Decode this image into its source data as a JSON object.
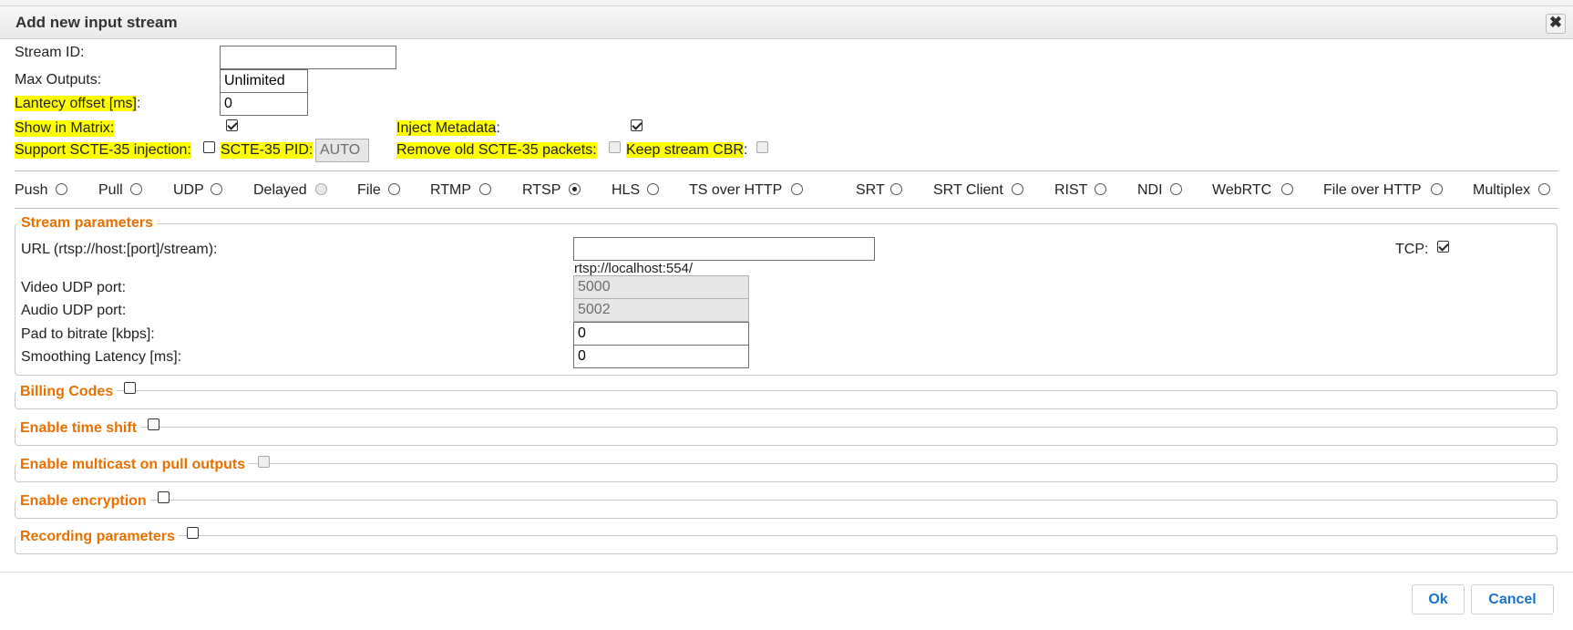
{
  "dialog": {
    "title": "Add new input stream",
    "close_glyph": "✖"
  },
  "form": {
    "stream_id": {
      "label": "Stream ID:",
      "value": ""
    },
    "max_outputs": {
      "label": "Max Outputs:",
      "value": "Unlimited"
    },
    "latency_offset": {
      "label": "Lantecy offset [ms]",
      "suffix": ":",
      "value": "0"
    },
    "show_in_matrix": {
      "label": "Show in Matrix:",
      "checked": true
    },
    "inject_metadata": {
      "label": "Inject Metadata",
      "suffix": ":",
      "checked": true
    },
    "scte35_injection": {
      "label": "Support SCTE-35 injection:",
      "checked": false
    },
    "scte35_pid": {
      "label": "SCTE-35 PID:",
      "value": "AUTO"
    },
    "remove_old_scte35": {
      "label": "Remove old SCTE-35 packets:",
      "checked": false
    },
    "keep_stream_cbr": {
      "label": "Keep stream CBR",
      "suffix": ":",
      "checked": false
    }
  },
  "stream_types": [
    {
      "label": "Push",
      "selected": false,
      "disabled": false
    },
    {
      "label": "Pull",
      "selected": false,
      "disabled": false
    },
    {
      "label": "UDP",
      "selected": false,
      "disabled": false
    },
    {
      "label": "Delayed",
      "selected": false,
      "disabled": true
    },
    {
      "label": "File",
      "selected": false,
      "disabled": false
    },
    {
      "label": "RTMP",
      "selected": false,
      "disabled": false
    },
    {
      "label": "RTSP",
      "selected": true,
      "disabled": false
    },
    {
      "label": "HLS",
      "selected": false,
      "disabled": false
    },
    {
      "label": "TS over HTTP",
      "selected": false,
      "disabled": false
    },
    {
      "label": "SRT",
      "selected": false,
      "disabled": false
    },
    {
      "label": "SRT Client",
      "selected": false,
      "disabled": false
    },
    {
      "label": "RIST",
      "selected": false,
      "disabled": false
    },
    {
      "label": "NDI",
      "selected": false,
      "disabled": false
    },
    {
      "label": "WebRTC",
      "selected": false,
      "disabled": false
    },
    {
      "label": "File over HTTP",
      "selected": false,
      "disabled": false
    },
    {
      "label": "Multiplex",
      "selected": false,
      "disabled": false
    }
  ],
  "stream_parameters": {
    "legend": "Stream parameters",
    "url": {
      "label": "URL (rtsp://host:[port]/stream):",
      "value": "",
      "hint": "rtsp://localhost:554/"
    },
    "tcp": {
      "label": "TCP:",
      "checked": true
    },
    "video_udp_port": {
      "label": "Video UDP port:",
      "value": "5000"
    },
    "audio_udp_port": {
      "label": "Audio UDP port:",
      "value": "5002"
    },
    "pad_to_bitrate": {
      "label": "Pad to bitrate [kbps]:",
      "value": "0"
    },
    "smoothing_latency": {
      "label": "Smoothing Latency [ms]:",
      "value": "0"
    }
  },
  "sections": [
    {
      "label": "Billing Codes",
      "checked": false,
      "disabled": false
    },
    {
      "label": "Enable time shift",
      "checked": false,
      "disabled": false
    },
    {
      "label": "Enable multicast on pull outputs",
      "checked": false,
      "disabled": true
    },
    {
      "label": "Enable encryption",
      "checked": false,
      "disabled": false
    },
    {
      "label": "Recording parameters",
      "checked": false,
      "disabled": false
    }
  ],
  "buttons": {
    "ok": "Ok",
    "cancel": "Cancel"
  }
}
